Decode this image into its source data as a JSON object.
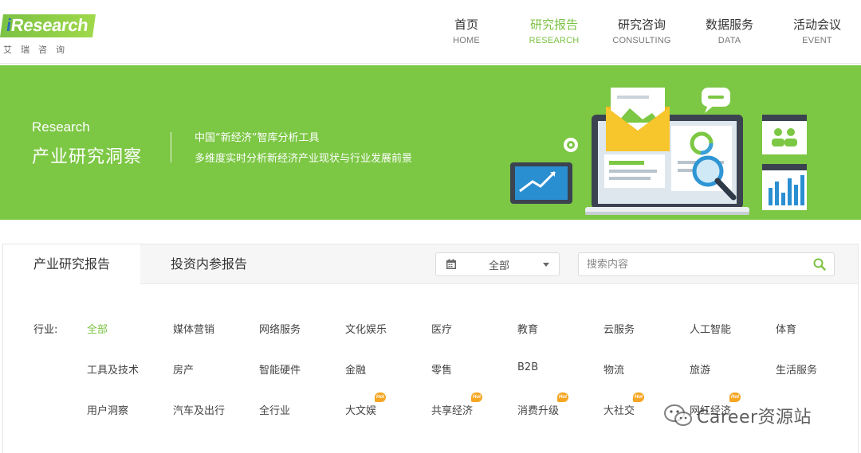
{
  "header": {
    "logo": {
      "wordmark_prefix": "i",
      "wordmark": "Research",
      "subtitle": "艾瑞咨询"
    },
    "nav": [
      {
        "zh": "首页",
        "en": "HOME",
        "active": false
      },
      {
        "zh": "研究报告",
        "en": "RESEARCH",
        "active": true
      },
      {
        "zh": "研究咨询",
        "en": "CONSULTING",
        "active": false
      },
      {
        "zh": "数据服务",
        "en": "DATA",
        "active": false
      },
      {
        "zh": "活动会议",
        "en": "EVENT",
        "active": false
      }
    ]
  },
  "banner": {
    "title_en": "Research",
    "title_zh": "产业研究洞察",
    "line1": "中国“新经济”智库分析工具",
    "line2": "多维度实时分析新经济产业现状与行业发展前景"
  },
  "tabs": [
    {
      "label": "产业研究报告",
      "active": true
    },
    {
      "label": "投资内参报告",
      "active": false
    }
  ],
  "filter": {
    "date_select_value": "全部",
    "search_placeholder": "搜索内容"
  },
  "industry": {
    "label": "行业:",
    "rows": [
      [
        {
          "label": "全部",
          "active": true
        },
        {
          "label": "媒体营销"
        },
        {
          "label": "网络服务"
        },
        {
          "label": "文化娱乐"
        },
        {
          "label": "医疗"
        },
        {
          "label": "教育"
        },
        {
          "label": "云服务"
        },
        {
          "label": "人工智能"
        },
        {
          "label": "体育"
        }
      ],
      [
        {
          "label": "工具及技术"
        },
        {
          "label": "房产"
        },
        {
          "label": "智能硬件"
        },
        {
          "label": "金融"
        },
        {
          "label": "零售"
        },
        {
          "label": "B2B"
        },
        {
          "label": "物流"
        },
        {
          "label": "旅游"
        },
        {
          "label": "生活服务"
        }
      ],
      [
        {
          "label": "用户洞察"
        },
        {
          "label": "汽车及出行"
        },
        {
          "label": "全行业"
        },
        {
          "label": "大文娱",
          "hot": true
        },
        {
          "label": "共享经济",
          "hot": true
        },
        {
          "label": "消费升级",
          "hot": true
        },
        {
          "label": "大社交",
          "hot": true
        },
        {
          "label": "网红经济",
          "hot": true
        }
      ]
    ],
    "hot_badge": "Hot"
  },
  "watermark": {
    "text": "Career资源站"
  },
  "colors": {
    "brand_green": "#7cc243",
    "banner_green": "#7cc744",
    "hot_orange": "#f5a623"
  }
}
